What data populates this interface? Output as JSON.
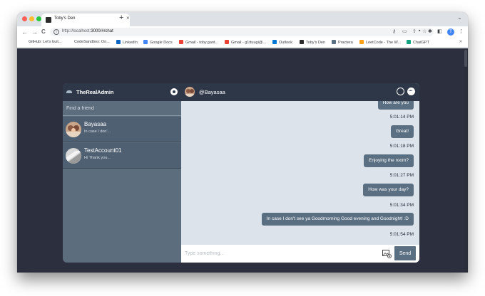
{
  "browser": {
    "tab_title": "Toby's Den",
    "tab_close": "×",
    "new_tab": "+",
    "url_host": "http://localhost",
    "url_path": ":3000/#/chat",
    "back": "←",
    "forward": "→",
    "reload": "C",
    "profile_initial": "T",
    "traffic_colors": [
      "#ff5f57",
      "#febc2e",
      "#28c840"
    ]
  },
  "bookmarks": [
    {
      "label": "GitHub: Let's buil...",
      "icon": "github-icon",
      "color": "#24292f"
    },
    {
      "label": "CodeSandbox: On...",
      "icon": "codesandbox-icon",
      "color": "#151515"
    },
    {
      "label": "LinkedIn",
      "icon": "linkedin-icon",
      "color": "#0a66c2"
    },
    {
      "label": "Google Docs",
      "icon": "docs-icon",
      "color": "#4285f4"
    },
    {
      "label": "Gmail - toby.gant...",
      "icon": "gmail-icon",
      "color": "#ea4335"
    },
    {
      "label": "Gmail - g1ttuugi@...",
      "icon": "gmail-icon",
      "color": "#ea4335"
    },
    {
      "label": "Outlook",
      "icon": "outlook-icon",
      "color": "#0078d4"
    },
    {
      "label": "Toby's Den",
      "icon": "tobysden-icon",
      "color": "#2b2b2b"
    },
    {
      "label": "Practera",
      "icon": "practera-icon",
      "color": "#5b6f82"
    },
    {
      "label": "LeetCode - The W...",
      "icon": "leetcode-icon",
      "color": "#ffa116"
    },
    {
      "label": "ChatGPT",
      "icon": "chatgpt-icon",
      "color": "#10a37f"
    }
  ],
  "sidebar": {
    "username": "TheRealAdmin",
    "search_placeholder": "Find a friend",
    "contacts": [
      {
        "name": "Bayasaa",
        "last_message": "In case I don'..."
      },
      {
        "name": "TestAccount01",
        "last_message": "Hi Thank you..."
      }
    ]
  },
  "chat": {
    "recipient": "@Bayasaa",
    "messages": [
      {
        "text": "How are you",
        "time": "5:01:14 PM"
      },
      {
        "text": "Great!",
        "time": "5:01:18 PM"
      },
      {
        "text": "Enjoying the room?",
        "time": "5:01:27 PM"
      },
      {
        "text": "How was your day?",
        "time": "5:01:34 PM"
      },
      {
        "text": "In case I don't see ya Goodmorning Good evening and Goodnight! :D",
        "time": "5:01:54 PM"
      }
    ],
    "input_placeholder": "Type something...",
    "send_label": "Send"
  },
  "colors": {
    "page_bg": "#2c2f3e",
    "header_bg": "#2d3748",
    "sidebar_bg": "#5c6d7e",
    "chat_bg": "#dde3ea",
    "bubble_bg": "#5b6f82"
  }
}
